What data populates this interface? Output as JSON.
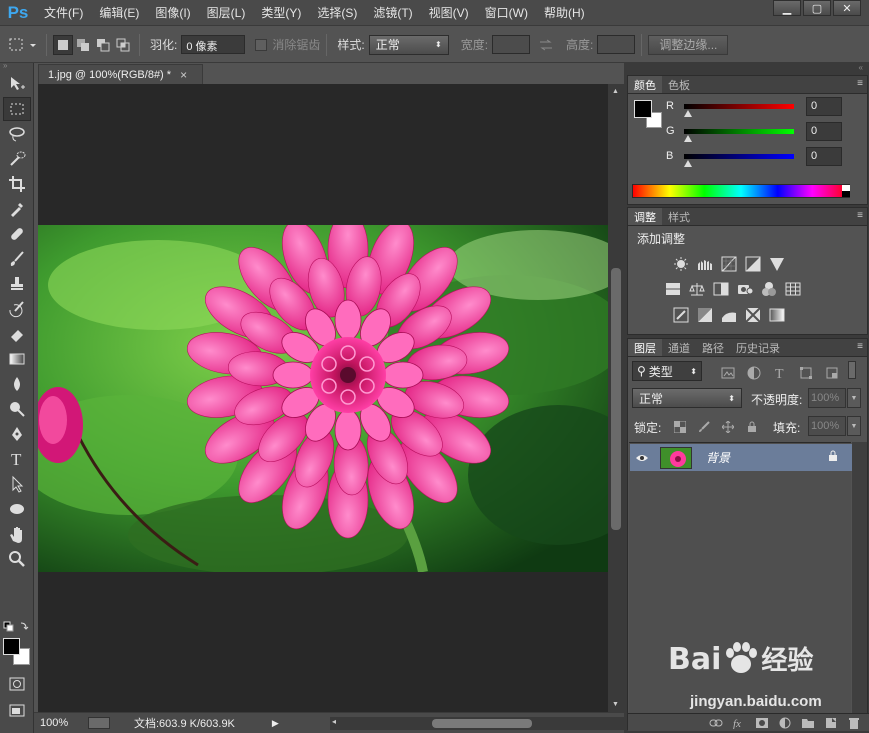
{
  "app": {
    "logo": "Ps"
  },
  "menu": [
    "文件(F)",
    "编辑(E)",
    "图像(I)",
    "图层(L)",
    "类型(Y)",
    "选择(S)",
    "滤镜(T)",
    "视图(V)",
    "窗口(W)",
    "帮助(H)"
  ],
  "window_controls": {
    "minimize": "▁",
    "maximize": "▢",
    "close": "✕"
  },
  "options": {
    "feather_label": "羽化:",
    "feather_value": "0 像素",
    "antialias_label": "消除锯齿",
    "style_label": "样式:",
    "style_value": "正常",
    "width_label": "宽度:",
    "height_label": "高度:",
    "refine_edge": "调整边缘..."
  },
  "document": {
    "tab_title": "1.jpg @ 100%(RGB/8#) *",
    "close": "×",
    "zoom": "100%",
    "doc_size": "文档:603.9 K/603.9K"
  },
  "color_panel": {
    "tabs": [
      "颜色",
      "色板"
    ],
    "channels": [
      {
        "label": "R",
        "value": "0"
      },
      {
        "label": "G",
        "value": "0"
      },
      {
        "label": "B",
        "value": "0"
      }
    ]
  },
  "adjust_panel": {
    "tabs": [
      "调整",
      "样式"
    ],
    "title": "添加调整"
  },
  "layers_panel": {
    "tabs": [
      "图层",
      "通道",
      "路径",
      "历史记录"
    ],
    "filter_kind": "类型",
    "blend_mode": "正常",
    "opacity_label": "不透明度:",
    "opacity_value": "100%",
    "lock_label": "锁定:",
    "fill_label": "填充:",
    "fill_value": "100%",
    "layers": [
      {
        "name": "背景",
        "visible": true,
        "locked": true
      }
    ]
  },
  "watermark": {
    "brand": "Bai",
    "brand2": "经验",
    "url": "jingyan.baidu.com"
  },
  "colors": {
    "foreground": "#000000",
    "background": "#ffffff",
    "layer_selected": "#6b7d9a",
    "ps_blue": "#3ea8f0"
  }
}
